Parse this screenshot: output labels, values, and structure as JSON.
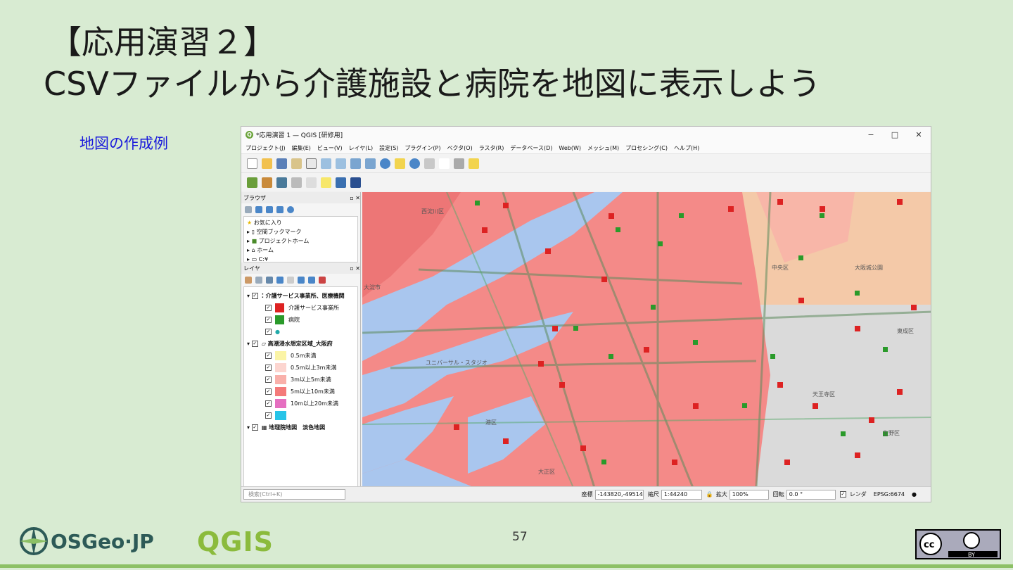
{
  "slide": {
    "title_line1": "【応用演習２】",
    "title_line2": "CSVファイルから介護施設と病院を地図に表示しよう",
    "subtitle": "地図の作成例",
    "page_number": "57"
  },
  "window": {
    "title": "*応用演習 1 — QGIS [研修用]",
    "controls": [
      "−",
      "□",
      "✕"
    ],
    "menu": [
      "プロジェクト(J)",
      "編集(E)",
      "ビュー(V)",
      "レイヤ(L)",
      "設定(S)",
      "プラグイン(P)",
      "ベクタ(O)",
      "ラスタ(R)",
      "データベース(D)",
      "Web(W)",
      "メッシュ(M)",
      "プロセシング(C)",
      "ヘルプ(H)"
    ]
  },
  "browser_panel": {
    "title": "ブラウザ",
    "items": [
      "お気に入り",
      "空間ブックマーク",
      "プロジェクトホーム",
      "ホーム",
      "C:¥"
    ]
  },
  "layers_panel": {
    "title": "レイヤ",
    "group1": "介護サービス事業所、医療機関",
    "group1_items": [
      "介護サービス事業所",
      "病院"
    ],
    "group2": "高潮浸水想定区域_大阪府",
    "group2_items": [
      "0.5m未満",
      "0.5m以上3m未満",
      "3m以上5m未満",
      "5m以上10m未満",
      "10m以上20m未満"
    ],
    "group3": "地理院地図　淡色地図"
  },
  "map_labels": [
    "西淀川区",
    "大淀市",
    "中央区",
    "大阪城公園",
    "東成区",
    "天王寺区",
    "生野区",
    "港区",
    "大正区",
    "ユニバーサル・スタジオ"
  ],
  "status_bar": {
    "search_placeholder": "検索(Ctrl+K)",
    "coord_label": "座標",
    "coord_value": "-143820,-49514",
    "scale_label": "縮尺",
    "scale_value": "1:44240",
    "zoom_label": "拡大",
    "zoom_value": "100%",
    "rotation_label": "回転",
    "rotation_value": "0.0 °",
    "render_label": "レンダ",
    "crs": "EPSG:6674"
  },
  "footer": {
    "osgeo_text": "OSGeo·JP",
    "qgis_text": "QGIS",
    "cc_text": "BY"
  },
  "colors": {
    "background": "#d8ebd2",
    "flood_05": "#fbf4a6",
    "flood_05_3": "#fcd5cf",
    "flood_3_5": "#f9b0aa",
    "flood_5_10": "#f47a7a",
    "flood_10_20": "#e56fc0",
    "water": "#27c4e8"
  }
}
